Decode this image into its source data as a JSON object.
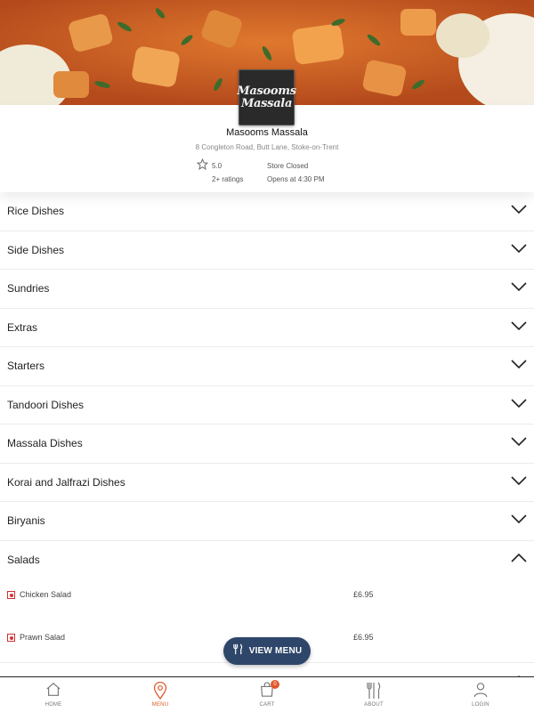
{
  "store": {
    "logo_text": "Masooms Massala",
    "name": "Masooms Massala",
    "address": "8 Congleton Road, Butt Lane, Stoke-on-Trent",
    "rating": "5.0",
    "ratings_count": "2+ ratings",
    "status": "Store Closed",
    "opens": "Opens at 4:30 PM"
  },
  "categories": [
    {
      "label": "Rice Dishes",
      "expanded": false
    },
    {
      "label": "Side Dishes",
      "expanded": false
    },
    {
      "label": "Sundries",
      "expanded": false
    },
    {
      "label": "Extras",
      "expanded": false
    },
    {
      "label": "Starters",
      "expanded": false
    },
    {
      "label": "Tandoori Dishes",
      "expanded": false
    },
    {
      "label": "Massala Dishes",
      "expanded": false
    },
    {
      "label": "Korai and Jalfrazi Dishes",
      "expanded": false
    },
    {
      "label": "Biryanis",
      "expanded": false
    },
    {
      "label": "Salads",
      "expanded": true
    }
  ],
  "salad_items": [
    {
      "name": "Chicken Salad",
      "price": "£6.95"
    },
    {
      "name": "Prawn Salad",
      "price": "£6.95"
    }
  ],
  "view_menu_button": {
    "label": "VIEW MENU",
    "icon": "cutlery-icon"
  },
  "tabbar": {
    "home": {
      "label": "HOME",
      "icon": "home-icon"
    },
    "menu": {
      "label": "MENU",
      "icon": "location-pin-icon"
    },
    "cart": {
      "label": "CART",
      "icon": "shopping-bag-icon",
      "badge": "0"
    },
    "about": {
      "label": "ABOUT",
      "icon": "cutlery-icon"
    },
    "login": {
      "label": "LOGIN",
      "icon": "user-icon"
    }
  },
  "colors": {
    "accent": "#e0582a",
    "button": "#2e4669"
  }
}
